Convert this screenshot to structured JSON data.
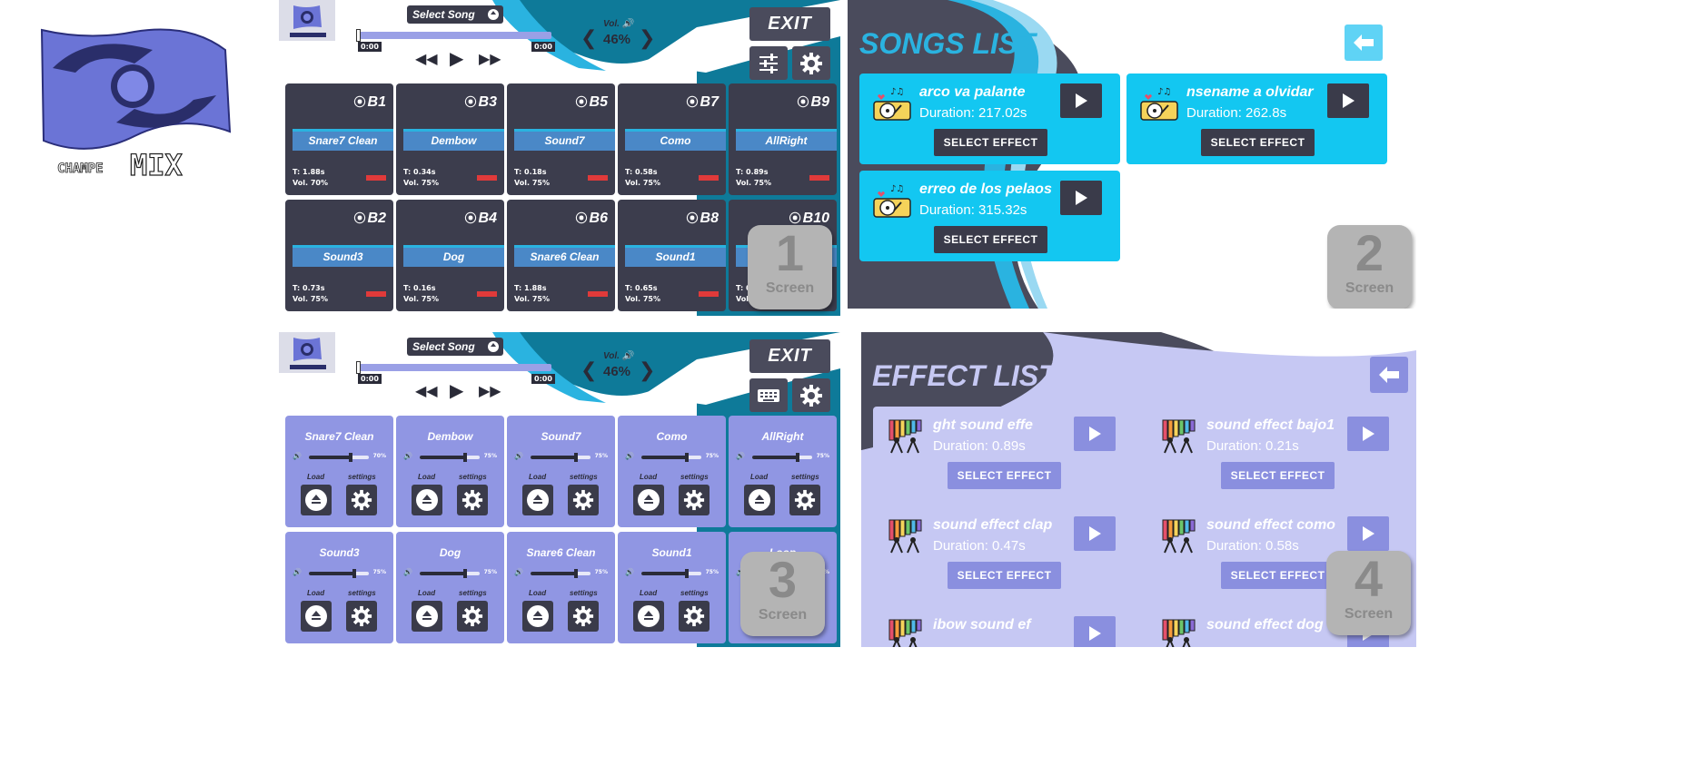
{
  "app": {
    "brand_left": "CHAMPE",
    "brand_right": "MIX"
  },
  "player": {
    "select_song": "Select Song",
    "time_start": "0:00",
    "time_end": "0:00",
    "volume_label": "Vol.",
    "volume_value": "46%",
    "exit_label": "EXIT"
  },
  "pads_screen1": [
    {
      "id": "B1",
      "name": "Snare7 Clean",
      "time": "T: 1.88s",
      "vol": "Vol. 70%"
    },
    {
      "id": "B3",
      "name": "Dembow",
      "time": "T: 0.34s",
      "vol": "Vol. 75%"
    },
    {
      "id": "B5",
      "name": "Sound7",
      "time": "T: 0.18s",
      "vol": "Vol. 75%"
    },
    {
      "id": "B7",
      "name": "Como",
      "time": "T: 0.58s",
      "vol": "Vol. 75%"
    },
    {
      "id": "B9",
      "name": "AllRight",
      "time": "T: 0.89s",
      "vol": "Vol. 75%"
    },
    {
      "id": "B2",
      "name": "Sound3",
      "time": "T: 0.73s",
      "vol": "Vol. 75%"
    },
    {
      "id": "B4",
      "name": "Dog",
      "time": "T: 0.16s",
      "vol": "Vol. 75%"
    },
    {
      "id": "B6",
      "name": "Snare6 Clean",
      "time": "T: 1.88s",
      "vol": "Vol. 75%"
    },
    {
      "id": "B8",
      "name": "Sound1",
      "time": "T: 0.65s",
      "vol": "Vol. 75%"
    },
    {
      "id": "B10",
      "name": "",
      "time": "T: 0",
      "vol": "Vol."
    }
  ],
  "pads_screen3": [
    {
      "name": "Snare7 Clean",
      "pct": "70%",
      "level": 0.7
    },
    {
      "name": "Dembow",
      "pct": "75%",
      "level": 0.75
    },
    {
      "name": "Sound7",
      "pct": "75%",
      "level": 0.75
    },
    {
      "name": "Como",
      "pct": "75%",
      "level": 0.75
    },
    {
      "name": "AllRight",
      "pct": "75%",
      "level": 0.75
    },
    {
      "name": "Sound3",
      "pct": "75%",
      "level": 0.75
    },
    {
      "name": "Dog",
      "pct": "75%",
      "level": 0.75
    },
    {
      "name": "Snare6 Clean",
      "pct": "75%",
      "level": 0.75
    },
    {
      "name": "Sound1",
      "pct": "75%",
      "level": 0.75
    },
    {
      "name": "Loop",
      "pct": "%",
      "level": 0.75
    }
  ],
  "pad_labels": {
    "load": "Load",
    "settings": "settings"
  },
  "badges": [
    {
      "num": "1",
      "label": "Screen"
    },
    {
      "num": "2",
      "label": "Screen"
    },
    {
      "num": "3",
      "label": "Screen"
    },
    {
      "num": "4",
      "label": "Screen"
    }
  ],
  "songs_list": {
    "title": "SONGS LIST",
    "select_label": "SELECT EFFECT",
    "items": [
      {
        "name": "arco va palante",
        "duration": "Duration: 217.02s"
      },
      {
        "name": "nsename a olvidar",
        "duration": "Duration: 262.8s"
      },
      {
        "name": "erreo de los pelaos",
        "duration": "Duration: 315.32s"
      }
    ]
  },
  "effect_list": {
    "title": "EFFECT LIST",
    "select_label": "SELECT EFFECT",
    "items": [
      {
        "name": "ght        sound effe",
        "duration": "Duration: 0.89s"
      },
      {
        "name": "sound effect bajo1",
        "duration": "Duration: 0.21s"
      },
      {
        "name": "sound effect clap",
        "duration": "Duration: 0.47s"
      },
      {
        "name": "sound effect como",
        "duration": "Duration: 0.58s"
      },
      {
        "name": "ibow        sound ef",
        "duration": ""
      },
      {
        "name": "sound effect dog",
        "duration": ""
      }
    ]
  },
  "colors": {
    "accent_blue": "#13c7f1",
    "lavender": "#9096e3",
    "dark": "#3c3d4d",
    "red_indicator": "#e03a3a"
  }
}
